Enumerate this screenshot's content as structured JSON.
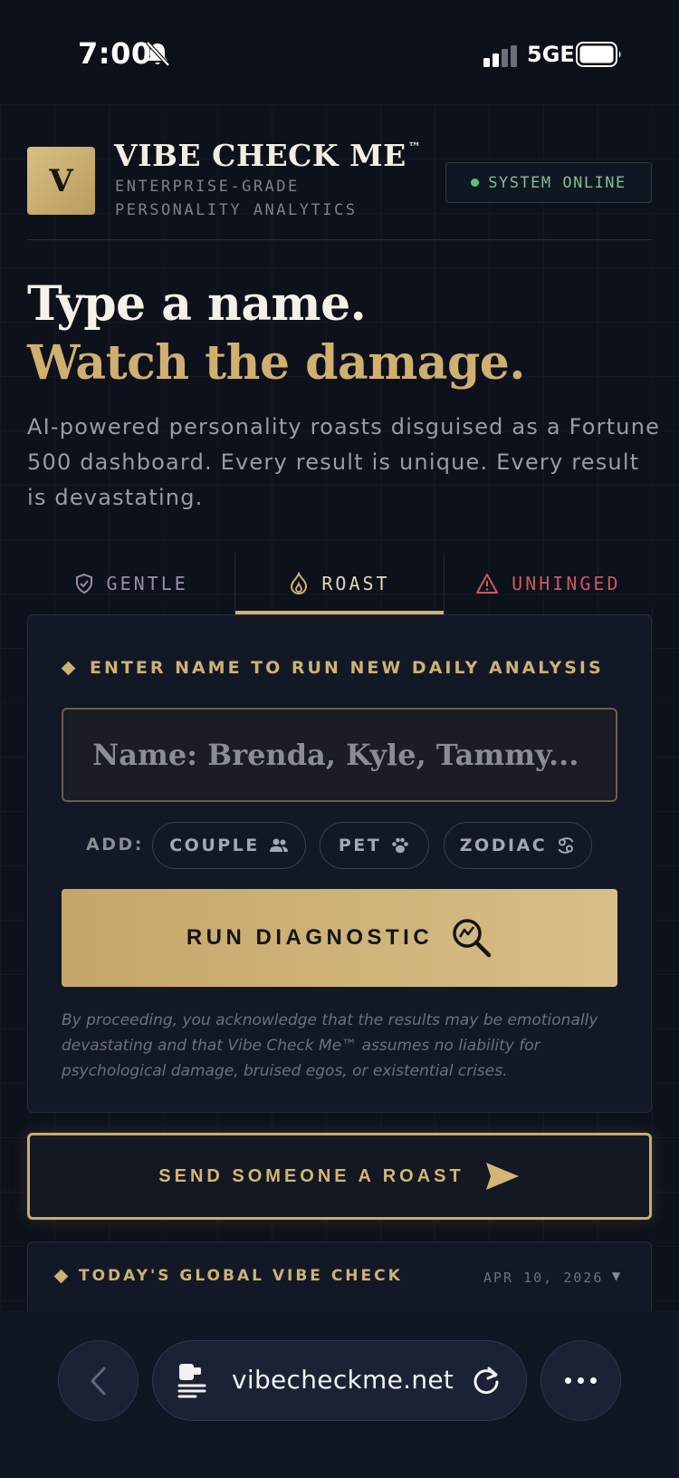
{
  "status_bar": {
    "time": "7:00",
    "network": "5GE"
  },
  "header": {
    "logo_letter": "V",
    "brand": "VIBE CHECK ME",
    "trademark": "™",
    "subtitle": "ENTERPRISE-GRADE PERSONALITY ANALYTICS",
    "status_badge": "SYSTEM ONLINE",
    "status_color": "#5bbf7a"
  },
  "hero": {
    "line1": "Type a name.",
    "line2": "Watch the damage.",
    "description": "AI-powered personality roasts disguised as a Fortune 500 dashboard. Every result is unique. Every result is devastating."
  },
  "tabs": [
    {
      "label": "GENTLE",
      "icon": "shield-check-icon",
      "active": false
    },
    {
      "label": "ROAST",
      "icon": "flame-icon",
      "active": true
    },
    {
      "label": "UNHINGED",
      "icon": "warning-icon",
      "active": false
    }
  ],
  "analysis": {
    "label": "ENTER NAME TO RUN NEW DAILY ANALYSIS",
    "input_value": "",
    "input_placeholder": "Name: Brenda, Kyle, Tammy...",
    "add_label": "ADD:",
    "chips": [
      {
        "label": "COUPLE",
        "icon": "people-icon"
      },
      {
        "label": "PET",
        "icon": "paw-icon"
      },
      {
        "label": "ZODIAC",
        "icon": "cancer-zodiac-icon"
      }
    ],
    "run_button": "RUN DIAGNOSTIC",
    "run_icon": "chart-magnifier-icon",
    "disclaimer": "By proceeding, you acknowledge that the results may be emotionally devastating and that Vibe Check Me™ assumes no liability for psychological damage, bruised egos, or existential crises."
  },
  "send_roast": {
    "label": "SEND SOMEONE A ROAST",
    "icon": "send-icon"
  },
  "global_vibe": {
    "label": "TODAY'S GLOBAL VIBE CHECK",
    "date": "APR 10, 2026",
    "caret": "▼"
  },
  "browser": {
    "url": "vibecheckme.net"
  },
  "colors": {
    "accent": "#cfb275",
    "background": "#0d111b",
    "danger": "#c9595a",
    "gentle": "#9e8aa8"
  }
}
